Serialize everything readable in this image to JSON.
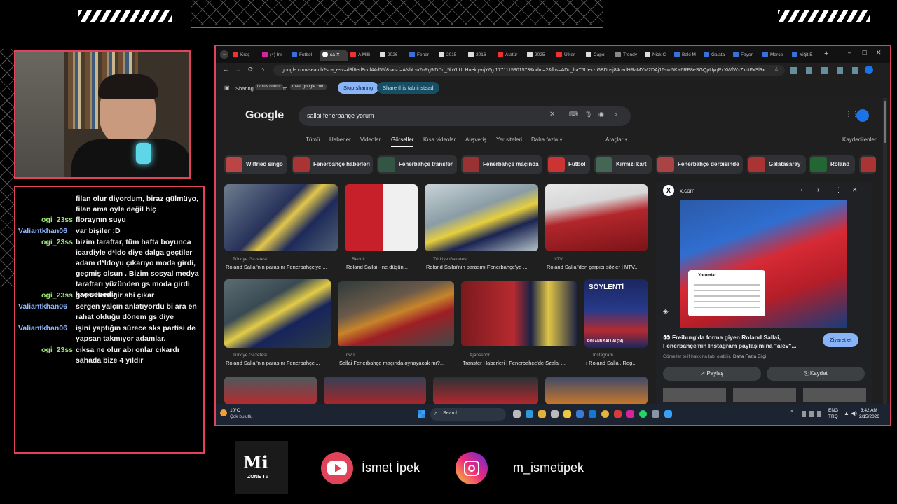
{
  "chat": {
    "messages": [
      {
        "user": "",
        "color": "#ffffff",
        "text": "filan olur diyordum, biraz gülmüyo, filan ama öyle değil hiç"
      },
      {
        "user": "ogi_23ss",
        "color": "#9be37a",
        "text": "floraynın suyu"
      },
      {
        "user": "Valiantkhan06",
        "color": "#8fb7ff",
        "text": "var bişiler :D"
      },
      {
        "user": "ogi_23ss",
        "color": "#9be37a",
        "text": "bizim taraftar, tüm hafta boyunca icardiyle d*ldo diye dalga geçtiler adam d*ldoyu çıkarıyo moda girdi, geçmiş olsun . Bizim sosyal medya taraftarı yüzünden gs moda girdi kaç senedir"
      },
      {
        "user": "ogi_23ss",
        "color": "#9be37a",
        "text": "görsellere gir abi çıkar"
      },
      {
        "user": "Valiantkhan06",
        "color": "#8fb7ff",
        "text": "sergen yalçın anlatıyordu bi ara en rahat olduğu dönem gs diye"
      },
      {
        "user": "Valiantkhan06",
        "color": "#8fb7ff",
        "text": "işini yaptığın sürece sks partisi de yapsan takmıyor adamlar."
      },
      {
        "user": "ogi_23ss",
        "color": "#9be37a",
        "text": "cıksa ne olur abı onlar cıkardı sahada bize 4 yıldır"
      }
    ]
  },
  "browser": {
    "tabs": [
      {
        "label": "Kraç",
        "color": "#e33"
      },
      {
        "label": "(4) Ins",
        "color": "#d6249f"
      },
      {
        "label": "Futbol",
        "color": "#3b6fd9"
      },
      {
        "label": "sa",
        "color": "#fff",
        "active": true
      },
      {
        "label": "A Milli",
        "color": "#e33"
      },
      {
        "label": "2026 ",
        "color": "#ddd"
      },
      {
        "label": "Fener",
        "color": "#3b6fd9"
      },
      {
        "label": "2015 ",
        "color": "#ddd"
      },
      {
        "label": "2016 ",
        "color": "#ddd"
      },
      {
        "label": "Atatür",
        "color": "#e33"
      },
      {
        "label": "2025-",
        "color": "#ddd"
      },
      {
        "label": "Ülker ",
        "color": "#e33"
      },
      {
        "label": "Capol",
        "color": "#ddd"
      },
      {
        "label": "Trendy",
        "color": "#888"
      },
      {
        "label": "Nick C",
        "color": "#ddd"
      },
      {
        "label": "Baki M",
        "color": "#3b6fd9"
      },
      {
        "label": "Galata",
        "color": "#3b6fd9"
      },
      {
        "label": "Feyen",
        "color": "#3b6fd9"
      },
      {
        "label": "Marco",
        "color": "#3b6fd9"
      },
      {
        "label": "Yiğit E",
        "color": "#3b6fd9"
      }
    ],
    "url": "google.com/search?sca_esv=d8f8ed9cdf44d55f&sxsrf=ANbL-n7nRg9lDDu_5bYLULHueklyvrjY6g:1771115901573&udm=2&fbs=ADc_l-aT5UekzIGBDhsj84cadHRaMYM2DAj16swl5KY6RP8eSGQpUyqPxXWfWxZxhtFxSl3x...",
    "sharing": {
      "label": "Sharing",
      "from": "tvplus.com.tr",
      "to_word": "to",
      "to": "meet.google.com",
      "stop": "Stop sharing",
      "share_this": "Share this tab instead"
    }
  },
  "google": {
    "logo": "Google",
    "query": "sallai fenerbahçe yorum",
    "nav": [
      "Tümü",
      "Haberler",
      "Videolar",
      "Görseller",
      "Kısa videolar",
      "Alışveriş",
      "Yer siteleri",
      "Daha fazla ▾"
    ],
    "active_nav": "Görseller",
    "tools": "Araçlar ▾",
    "saved": "Kaydedilenler",
    "chips": [
      "Wilfried singo",
      "Fenerbahçe haberleri",
      "Fenerbahçe transfer",
      "Fenerbahçe maçında",
      "Futbol",
      "Kırmızı kart",
      "Fenerbahçe derbisinde",
      "Galatasaray",
      "Roland"
    ],
    "results": [
      {
        "source": "Türkiye Gazetesi",
        "caption": "Roland Sallai'nin parasını Fenerbahçe'ye ..."
      },
      {
        "source": "Reddit",
        "caption": "Roland Sallai - ne düşün..."
      },
      {
        "source": "Türkiye Gazetesi",
        "caption": "Roland Sallai'nin parasını Fenerbahçe'ye ..."
      },
      {
        "source": "NTV",
        "caption": "Roland Sallai'den çarpıcı sözler | NTV..."
      },
      {
        "source": "Türkiye Gazetesi",
        "caption": "Roland Sallai'nin parasını Fenerbahçe'..."
      },
      {
        "source": "GZT",
        "caption": "Sallai Fenerbahçe maçında oynayacak mı?..."
      },
      {
        "source": "Ajansspor",
        "caption": "Transfer Haberleri | Fenerbahçe'de Szalai ..."
      },
      {
        "source": "Instagram",
        "caption": "ı Roland Sallai, Rog..."
      }
    ],
    "preview": {
      "site": "x.com",
      "title": "👀 Freiburg'da forma giyen Roland Sallai, Fenerbahçe'nin Instagram paylaşımına \"alev\"...",
      "visit": "Ziyaret et",
      "copyright": "Görseller telif hakkına tabi olabilir.",
      "more": "Daha Fazla Bilgi",
      "share": "Paylaş",
      "save": "Kaydet",
      "comments_title": "Yorumlar",
      "soylenti": "SÖYLENTİ",
      "badge": "ROLAND SALLAI (24)"
    }
  },
  "taskbar": {
    "weather_temp": "10°C",
    "weather_desc": "Çok bulutlu",
    "search": "Search",
    "lang1": "ENG",
    "lang2": "TRQ",
    "time": "3:42 AM",
    "date": "2/15/2026"
  },
  "overlay": {
    "logo_main": "Mi",
    "logo_sub": "ZONE TV",
    "youtube_name": "İsmet İpek",
    "instagram_name": "m_ismetipek"
  },
  "colors": {
    "accent": "#e0435a",
    "chat_user_green": "#9be37a",
    "chat_user_blue": "#8fb7ff"
  }
}
